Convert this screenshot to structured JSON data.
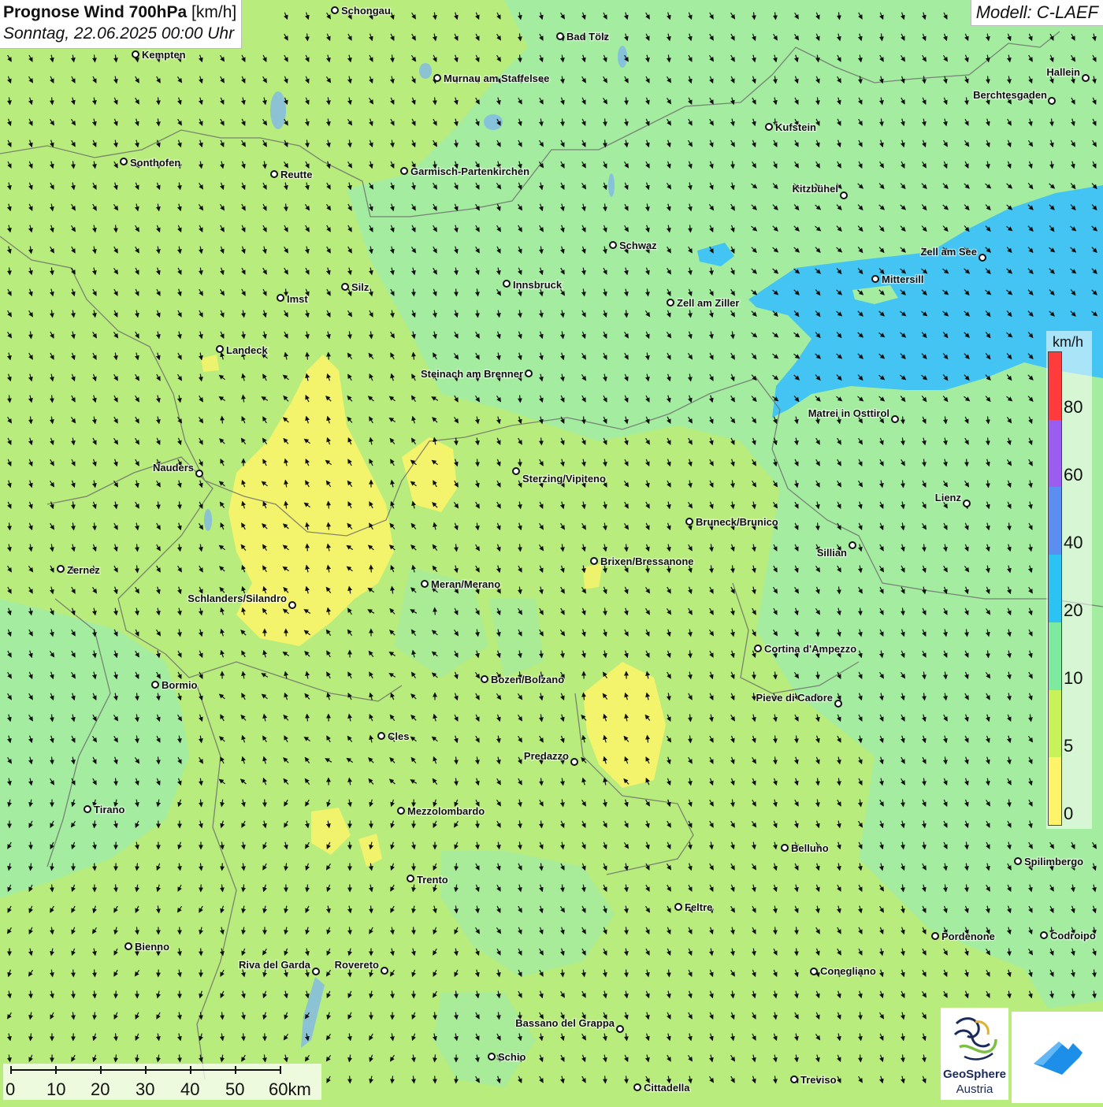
{
  "title": {
    "bold": "Prognose Wind 700hPa",
    "unit": " [km/h]",
    "date": "Sonntag, 22.06.2025 00:00 Uhr"
  },
  "model": "Modell: C-LAEF",
  "legend": {
    "unit": "km/h",
    "ticks": [
      "80",
      "60",
      "40",
      "20",
      "10",
      "5",
      "0"
    ],
    "colors": [
      "#ff3b3b",
      "#9b5cf0",
      "#5a8ef0",
      "#2cc3f2",
      "#7eeaa0",
      "#c8f25a",
      "#fff36a"
    ]
  },
  "scalebar": {
    "labels": [
      "0",
      "10",
      "20",
      "30",
      "40",
      "50",
      "60km"
    ]
  },
  "logos": {
    "geosphere_name": "GeoSphere",
    "geosphere_sub": "Austria"
  },
  "wind_field": {
    "arrows": "dense grid of black wind arrows, mostly pointing down and to the right"
  },
  "cities": [
    {
      "name": "Schongau"
    },
    {
      "name": "Kempten"
    },
    {
      "name": "Bad Tölz"
    },
    {
      "name": "Murnau am Staffelsee"
    },
    {
      "name": "Hallein"
    },
    {
      "name": "Berchtesgaden"
    },
    {
      "name": "Kufstein"
    },
    {
      "name": "Sonthofen"
    },
    {
      "name": "Reutte"
    },
    {
      "name": "Garmisch-Partenkirchen"
    },
    {
      "name": "Kitzbühel"
    },
    {
      "name": "Schwaz"
    },
    {
      "name": "Zell am See"
    },
    {
      "name": "Mittersill"
    },
    {
      "name": "Silz"
    },
    {
      "name": "Innsbruck"
    },
    {
      "name": "Imst"
    },
    {
      "name": "Zell am Ziller"
    },
    {
      "name": "Landeck"
    },
    {
      "name": "Steinach am Brenner"
    },
    {
      "name": "Matrei in Osttirol"
    },
    {
      "name": "Nauders"
    },
    {
      "name": "Sterzing/Vipiteno"
    },
    {
      "name": "Lienz"
    },
    {
      "name": "Bruneck/Brunico"
    },
    {
      "name": "Sillian"
    },
    {
      "name": "Zernez"
    },
    {
      "name": "Brixen/Bressanone"
    },
    {
      "name": "Meran/Merano"
    },
    {
      "name": "Schlanders/Silandro"
    },
    {
      "name": "Cortina d'Ampezzo"
    },
    {
      "name": "Bormio"
    },
    {
      "name": "Bozen/Bolzano"
    },
    {
      "name": "Pieve di Cadore"
    },
    {
      "name": "Cles"
    },
    {
      "name": "Predazzo"
    },
    {
      "name": "Tirano"
    },
    {
      "name": "Mezzolombardo"
    },
    {
      "name": "Belluno"
    },
    {
      "name": "Spilimbergo"
    },
    {
      "name": "Trento"
    },
    {
      "name": "Feltre"
    },
    {
      "name": "Bienno"
    },
    {
      "name": "Pordenone"
    },
    {
      "name": "Codroipo"
    },
    {
      "name": "Riva del Garda"
    },
    {
      "name": "Rovereto"
    },
    {
      "name": "Conegliano"
    },
    {
      "name": "Bassano del Grappa"
    },
    {
      "name": "Schio"
    },
    {
      "name": "Treviso"
    },
    {
      "name": "Cittadella"
    }
  ]
}
